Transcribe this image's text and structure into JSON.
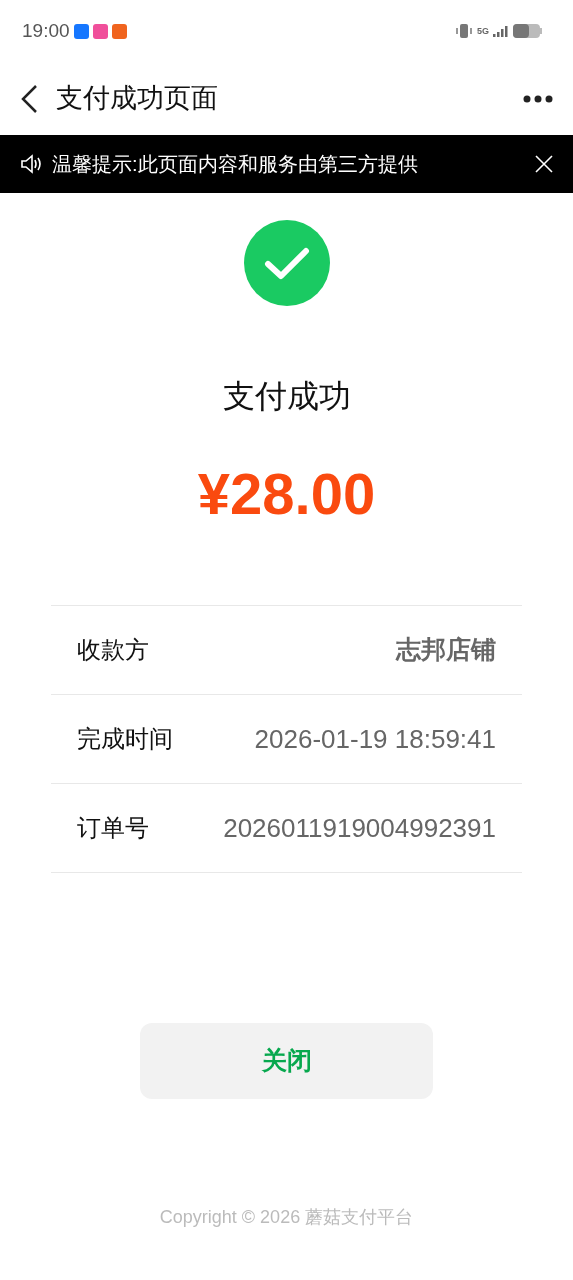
{
  "status_bar": {
    "time": "19:00",
    "network": "5G"
  },
  "nav": {
    "title": "支付成功页面"
  },
  "notice": {
    "text": "温馨提示:此页面内容和服务由第三方提供"
  },
  "result": {
    "title": "支付成功",
    "amount": "¥28.00"
  },
  "details": [
    {
      "label": "收款方",
      "value": "志邦店铺",
      "kind": "strong"
    },
    {
      "label": "完成时间",
      "value": "2026-01-19 18:59:41",
      "kind": "plain"
    },
    {
      "label": "订单号",
      "value": "2026011919004992391",
      "kind": "plain"
    }
  ],
  "close_button": "关闭",
  "footer": "Copyright © 2026 蘑菇支付平台"
}
